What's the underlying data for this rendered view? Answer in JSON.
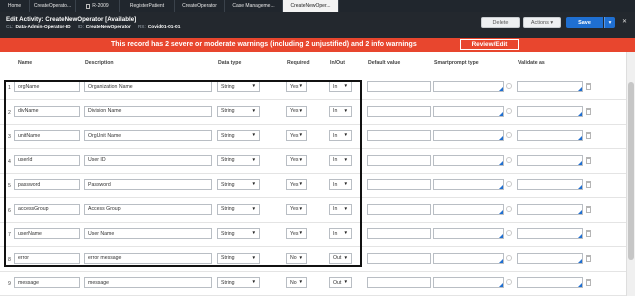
{
  "tabs": [
    {
      "label": "Home",
      "active": false
    },
    {
      "label": "CreateOperato...",
      "active": false
    },
    {
      "label": "R-2009",
      "active": false
    },
    {
      "label": "RegisterPatient",
      "active": false
    },
    {
      "label": "CreateOperator",
      "active": false
    },
    {
      "label": "Case Manageme...",
      "active": false
    },
    {
      "label": "CreateNewOper...",
      "active": true
    }
  ],
  "header": {
    "title": "Edit  Activity: CreateNewOperator [Available]",
    "class_key": "CL:",
    "class_value": "Data-Admin-Operator-ID",
    "id_key": "ID:",
    "id_value": "CreateNewOperator",
    "rs_key": "RS:",
    "rs_value": "Covid01-01-01",
    "delete_label": "Delete",
    "actions_label": "Actions ▾",
    "save_label": "Save",
    "save_menu_label": "▾",
    "close_label": "✕"
  },
  "banner": {
    "text": "This record has 2 severe or moderate warnings (including 2 unjustified) and 2 info warnings",
    "review_label": "Review/Edit",
    "color": "#e8462e"
  },
  "columns": [
    "Name",
    "Description",
    "Data type",
    "Required",
    "In/Out",
    "Default value",
    "Smartprompt type",
    "Validate as"
  ],
  "rows": [
    {
      "num": "1",
      "name": "orgName",
      "description": "Organization Name",
      "data_type": "String",
      "required": "Yes",
      "in_out": "In"
    },
    {
      "num": "2",
      "name": "divName",
      "description": "Division Name",
      "data_type": "String",
      "required": "Yes",
      "in_out": "In"
    },
    {
      "num": "3",
      "name": "unitName",
      "description": "OrgUnit Name",
      "data_type": "String",
      "required": "Yes",
      "in_out": "In"
    },
    {
      "num": "4",
      "name": "userId",
      "description": "User ID",
      "data_type": "String",
      "required": "Yes",
      "in_out": "In"
    },
    {
      "num": "5",
      "name": "password",
      "description": "Password",
      "data_type": "String",
      "required": "Yes",
      "in_out": "In"
    },
    {
      "num": "6",
      "name": "accessGroup",
      "description": "Access Group",
      "data_type": "String",
      "required": "Yes",
      "in_out": "In"
    },
    {
      "num": "7",
      "name": "userName",
      "description": "User Name",
      "data_type": "String",
      "required": "Yes",
      "in_out": "In"
    },
    {
      "num": "8",
      "name": "error",
      "description": "error message",
      "data_type": "String",
      "required": "No",
      "in_out": "Out"
    },
    {
      "num": "9",
      "name": "message",
      "description": "message",
      "data_type": "String",
      "required": "No",
      "in_out": "Out"
    }
  ],
  "accent_color": "#1f6fd1"
}
